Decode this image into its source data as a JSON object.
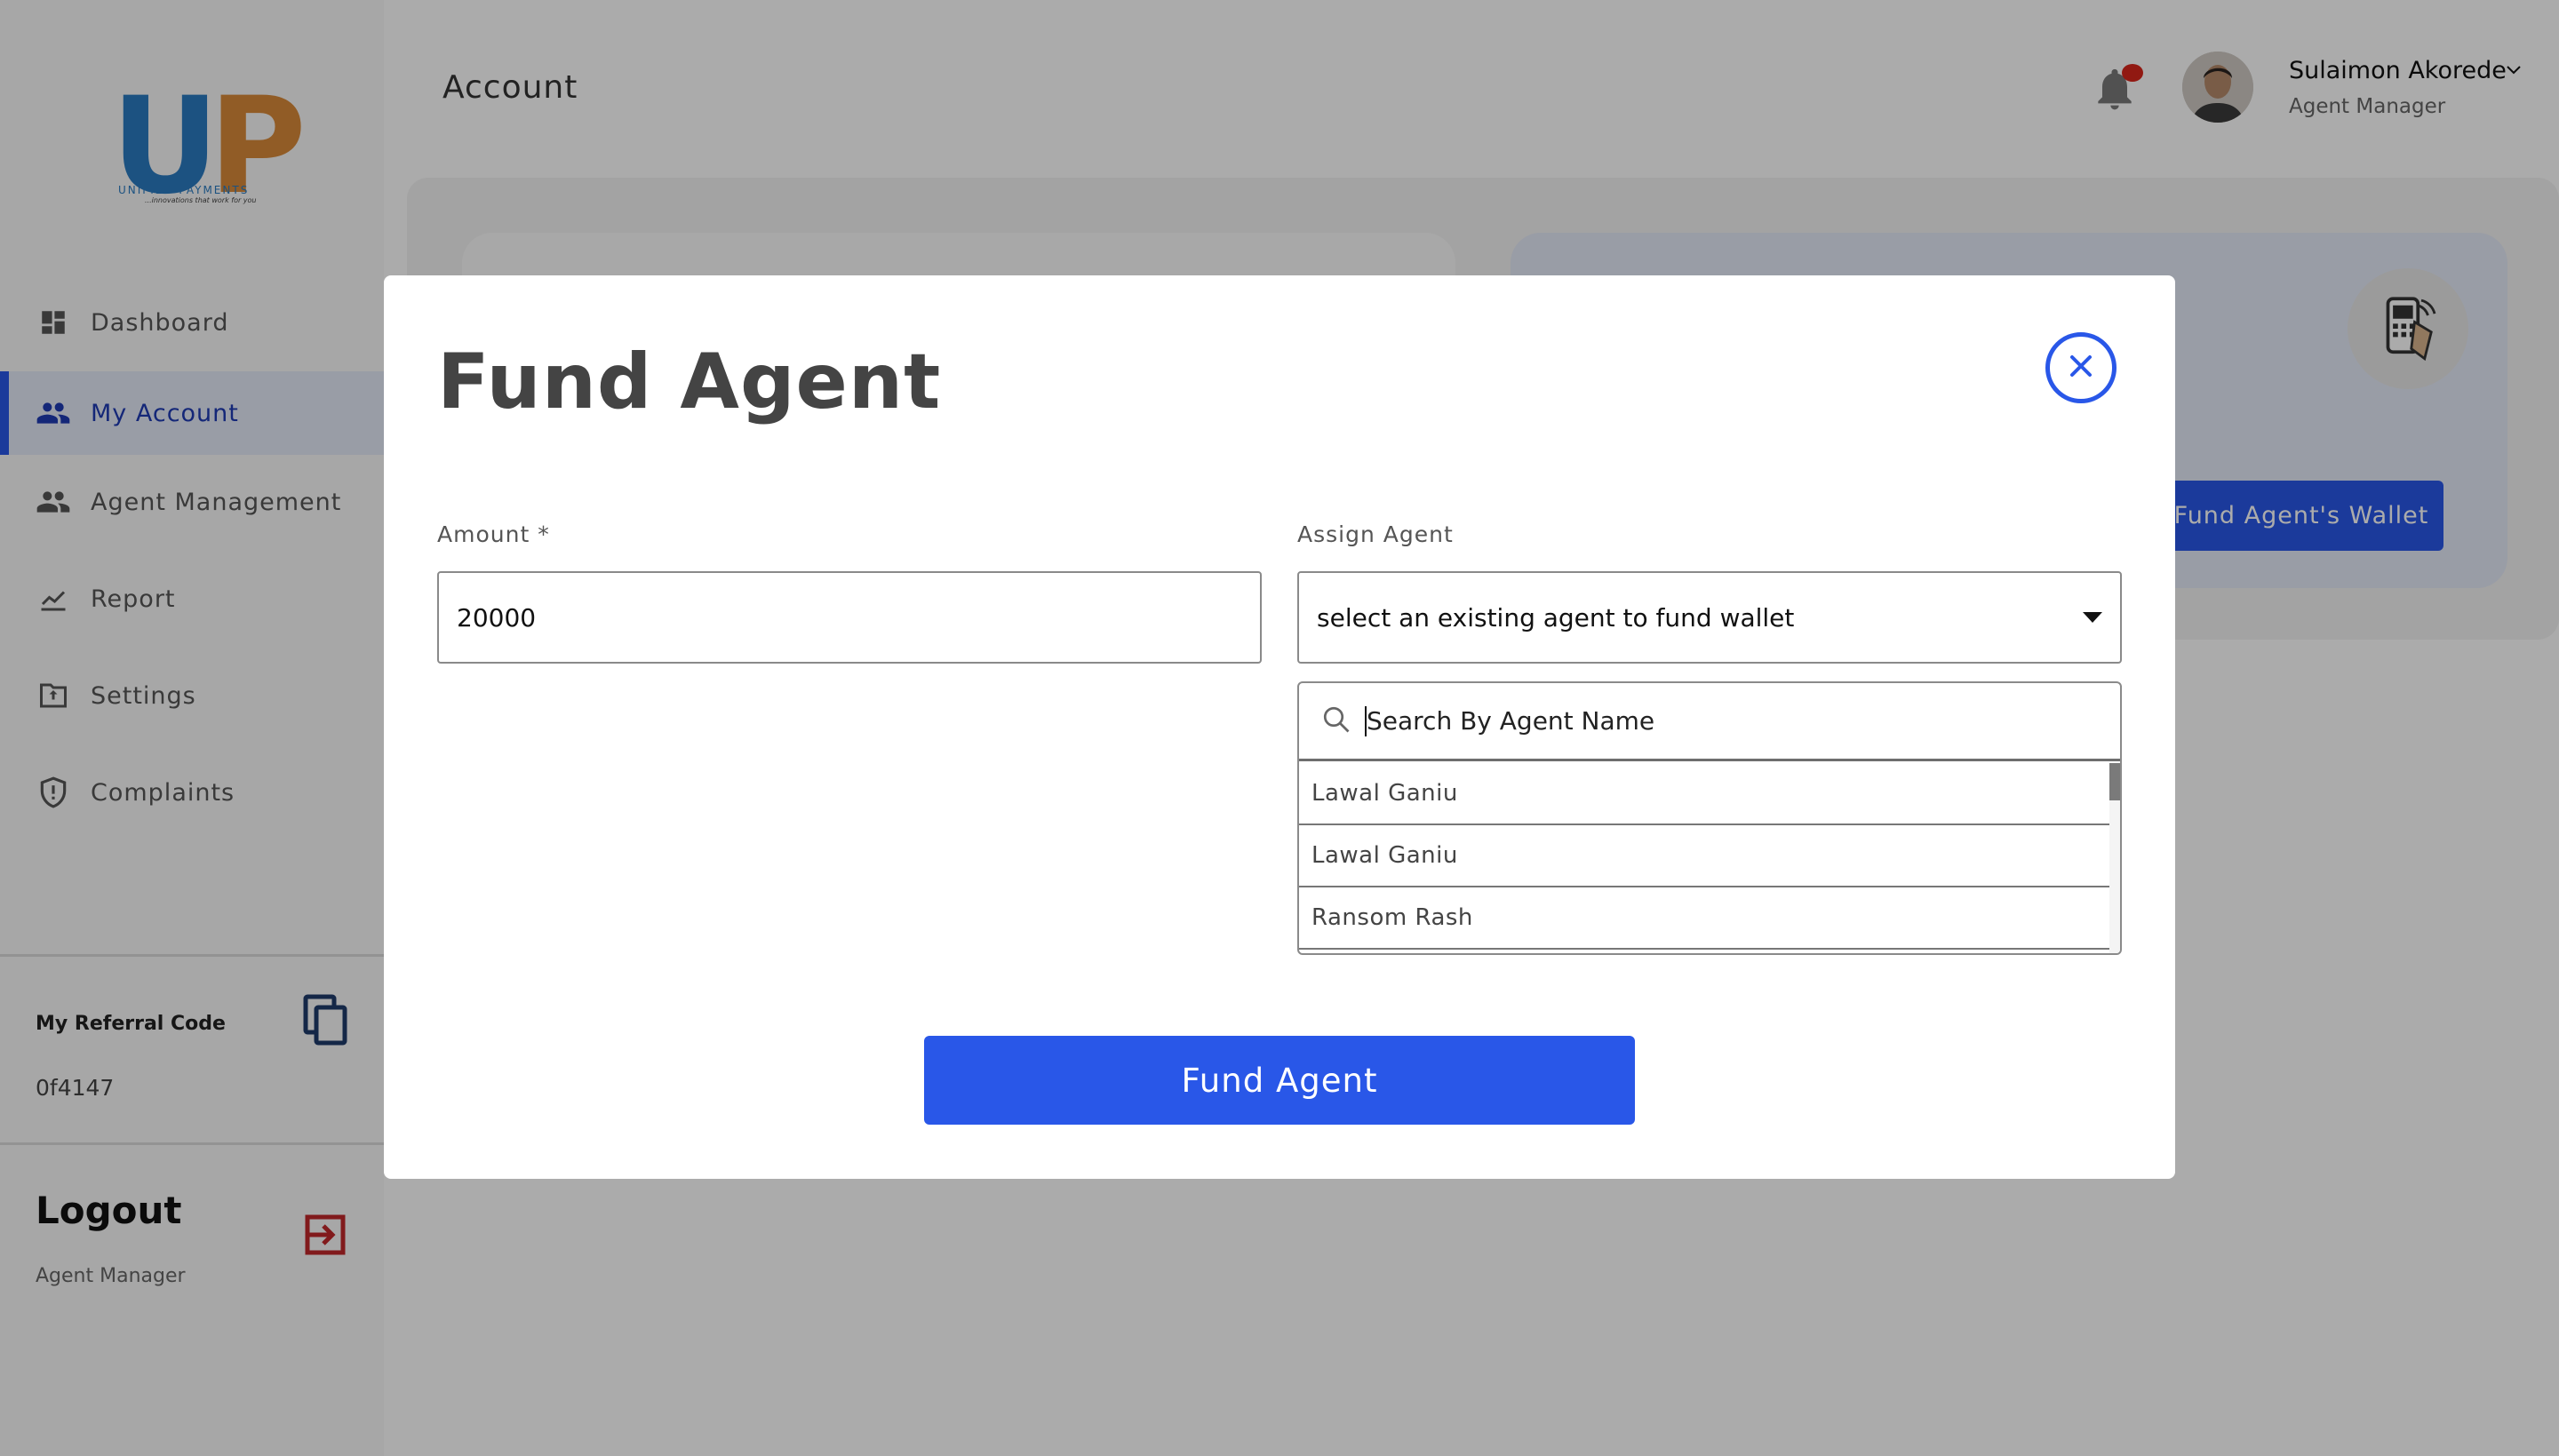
{
  "brand": {
    "logo_letters_u": "U",
    "logo_letters_p": "P",
    "logo_name": "UNIFIED PAYMENTS",
    "logo_tagline": "...innovations that work for you",
    "colors": {
      "logo_blue": "#2a7bc0",
      "logo_orange": "#d8893a",
      "accent": "#2957e8",
      "danger": "#d9261c"
    }
  },
  "sidebar": {
    "items": [
      {
        "label": "Dashboard",
        "icon": "dashboard-icon"
      },
      {
        "label": "My Account",
        "icon": "people-icon",
        "active": true
      },
      {
        "label": "Agent Management",
        "icon": "people-icon"
      },
      {
        "label": "Report",
        "icon": "chart-line-icon"
      },
      {
        "label": "Settings",
        "icon": "settings-folder-icon"
      },
      {
        "label": "Complaints",
        "icon": "shield-alert-icon"
      }
    ],
    "referral_label": "My Referral Code",
    "referral_code": "0f4147",
    "logout_title": "Logout",
    "logout_role": "Agent Manager"
  },
  "header": {
    "page_title": "Account",
    "user_name": "Sulaimon Akorede",
    "user_role": "Agent Manager"
  },
  "background": {
    "fund_wallet_button": "Fund Agent's Wallet"
  },
  "modal": {
    "title": "Fund Agent",
    "amount_label": "Amount *",
    "amount_value": "20000",
    "assign_label": "Assign Agent",
    "assign_value": "select an existing agent to fund wallet",
    "search_placeholder": "Search By Agent Name",
    "agents": [
      "Lawal Ganiu",
      "Lawal Ganiu",
      "Ransom Rash"
    ],
    "submit_label": "Fund Agent"
  }
}
